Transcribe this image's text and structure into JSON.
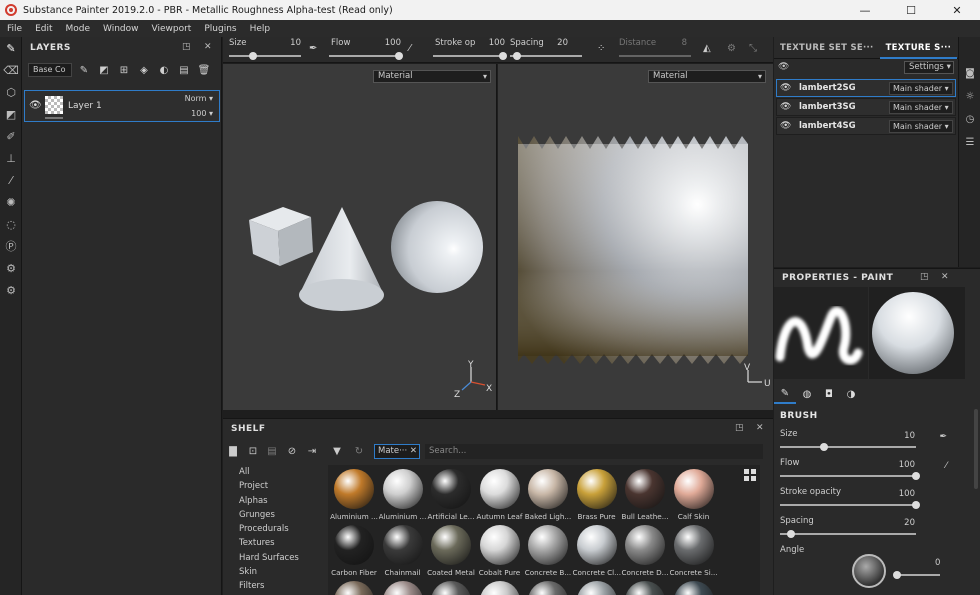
{
  "window": {
    "title": "Substance Painter 2019.2.0 - PBR - Metallic Roughness Alpha-test (Read only)",
    "controls": [
      "—",
      "☐",
      "✕"
    ]
  },
  "menu": [
    "File",
    "Edit",
    "Mode",
    "Window",
    "Viewport",
    "Plugins",
    "Help"
  ],
  "layers": {
    "title": "LAYERS",
    "blend_mode": "Base Co",
    "layer": {
      "name": "Layer 1",
      "blend": "Norm",
      "opacity": "100"
    }
  },
  "toolbar": {
    "size": {
      "label": "Size",
      "value": "10"
    },
    "flow": {
      "label": "Flow",
      "value": "100"
    },
    "stroke": {
      "label": "Stroke op",
      "value": "100"
    },
    "spacing": {
      "label": "Spacing",
      "value": "20"
    },
    "distance": {
      "label": "Distance",
      "value": "8"
    }
  },
  "viewports": {
    "left_mode": "Material",
    "right_mode": "Material",
    "axis_y": "Y",
    "axis_x": "X",
    "axis_z": "Z",
    "axis_v": "V",
    "axis_u": "U"
  },
  "shelf": {
    "title": "SHELF",
    "filter": "Mate···",
    "search_placeholder": "Search...",
    "categories": [
      "All",
      "Project",
      "Alphas",
      "Grunges",
      "Procedurals",
      "Textures",
      "Hard Surfaces",
      "Skin",
      "Filters"
    ],
    "materials": [
      {
        "name": "Aluminium ...",
        "color": "#c07a2a"
      },
      {
        "name": "Aluminium ...",
        "color": "#cfcfcf"
      },
      {
        "name": "Artificial Le...",
        "color": "#2c2c2c"
      },
      {
        "name": "Autumn Leaf",
        "color": "#dcdcdc"
      },
      {
        "name": "Baked Ligh...",
        "color": "#c9b8a8"
      },
      {
        "name": "Brass Pure",
        "color": "#c9a13a"
      },
      {
        "name": "Bull Leathe...",
        "color": "#4a3530"
      },
      {
        "name": "Calf Skin",
        "color": "#e0aa98"
      },
      {
        "name": "Carbon Fiber",
        "color": "#222222"
      },
      {
        "name": "Chainmail",
        "color": "#3a3a3a"
      },
      {
        "name": "Coated Metal",
        "color": "#6b6a5a"
      },
      {
        "name": "Cobalt Pure",
        "color": "#d6d6d6"
      },
      {
        "name": "Concrete B...",
        "color": "#a8a8a8"
      },
      {
        "name": "Concrete Cl...",
        "color": "#c8ccd0"
      },
      {
        "name": "Concrete D...",
        "color": "#8a8a8a"
      },
      {
        "name": "Concrete Si...",
        "color": "#6a6c6e"
      }
    ]
  },
  "texture_set": {
    "tab1": "TEXTURE SET SE···",
    "tab2": "TEXTURE S···",
    "settings": "Settings",
    "sets": [
      {
        "name": "lambert2SG",
        "shader": "Main shader"
      },
      {
        "name": "lambert3SG",
        "shader": "Main shader"
      },
      {
        "name": "lambert4SG",
        "shader": "Main shader"
      }
    ]
  },
  "properties": {
    "title": "PROPERTIES - PAINT",
    "section": "BRUSH",
    "size": {
      "label": "Size",
      "value": "10",
      "fraction": 0.3
    },
    "flow": {
      "label": "Flow",
      "value": "100",
      "fraction": 1.0
    },
    "stroke_opacity": {
      "label": "Stroke opacity",
      "value": "100",
      "fraction": 1.0
    },
    "spacing": {
      "label": "Spacing",
      "value": "20",
      "fraction": 0.05
    },
    "angle": {
      "label": "Angle",
      "value": "0"
    }
  }
}
